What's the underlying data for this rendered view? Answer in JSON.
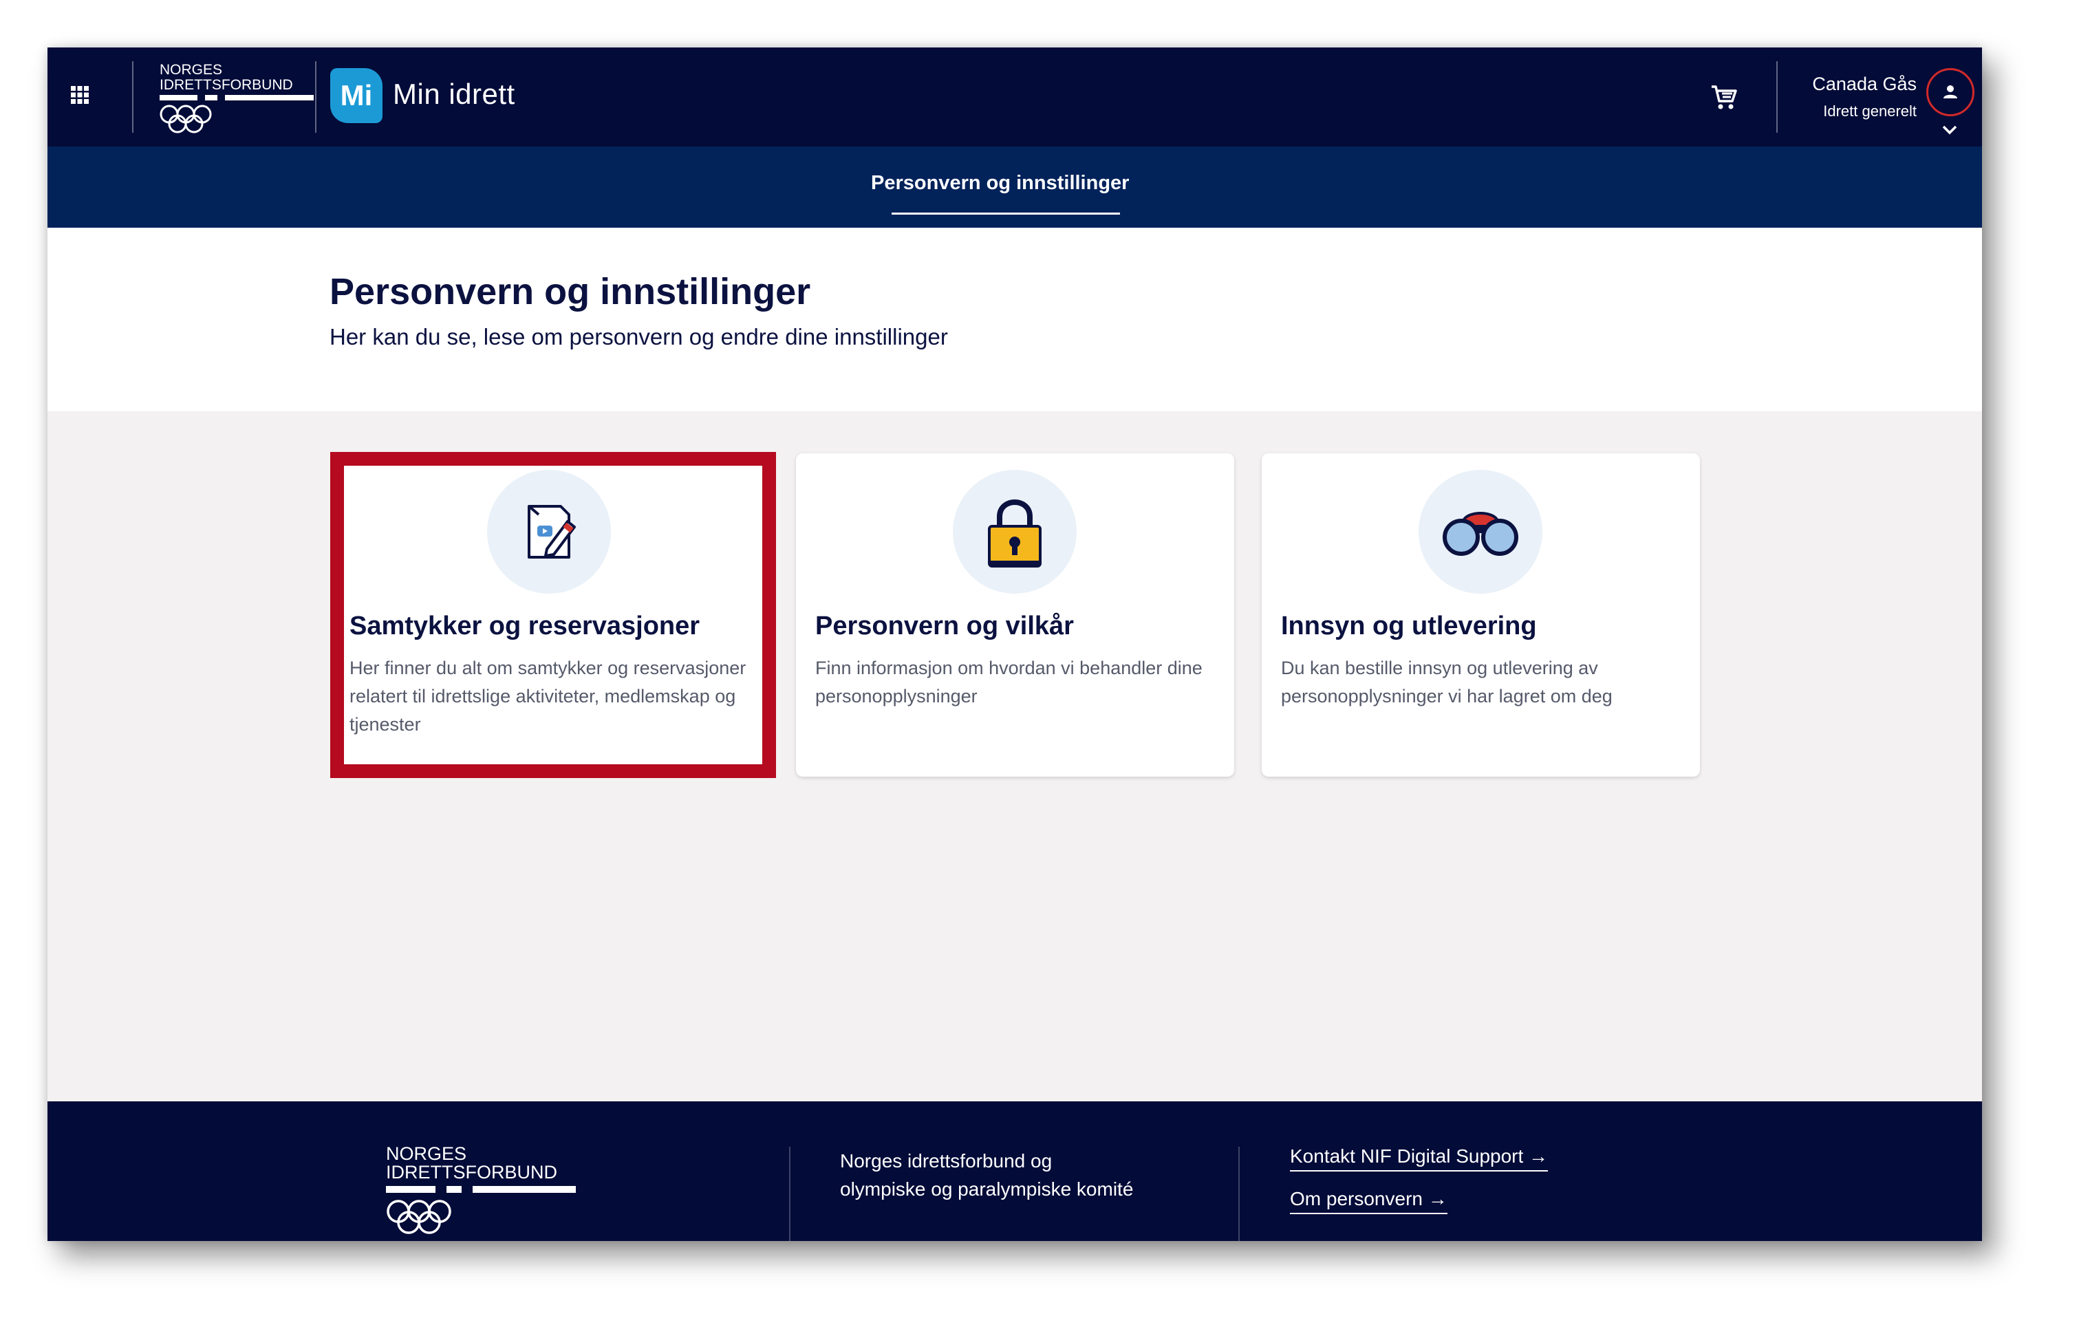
{
  "header": {
    "brand_line1": "NORGES",
    "brand_line2": "IDRETTSFORBUND",
    "app_badge": "Mi",
    "app_name": "Min idrett",
    "user_name": "Canada Gås",
    "user_org": "Idrett generelt"
  },
  "subnav": {
    "tab_label": "Personvern og innstillinger"
  },
  "hero": {
    "title": "Personvern og innstillinger",
    "subtitle": "Her kan du se, lese om personvern og endre dine innstillinger"
  },
  "cards": [
    {
      "icon": "consent-document-icon",
      "title": "Samtykker og reservasjoner",
      "description": "Her finner du alt om samtykker og reservasjoner relatert til idrettslige aktiviteter, medlemskap og tjenester"
    },
    {
      "icon": "padlock-icon",
      "title": "Personvern og vilkår",
      "description": "Finn informasjon om hvordan vi behandler dine personopplysninger"
    },
    {
      "icon": "binoculars-icon",
      "title": "Innsyn og utlevering",
      "description": "Du kan bestille innsyn og utlevering av personopplysninger vi har lagret om deg"
    }
  ],
  "footer": {
    "brand_line1": "NORGES",
    "brand_line2": "IDRETTSFORBUND",
    "org_line1": "Norges idrettsforbund og",
    "org_line2": "olympiske og paralympiske komité",
    "link_support": "Kontakt NIF Digital Support →",
    "link_privacy": "Om personvern →"
  },
  "colors": {
    "header_bg": "#030b38",
    "subnav_bg": "#02225a",
    "highlight": "#b50a1f",
    "mi_badge": "#1c9ad6",
    "lock_yellow": "#f5b81c"
  }
}
